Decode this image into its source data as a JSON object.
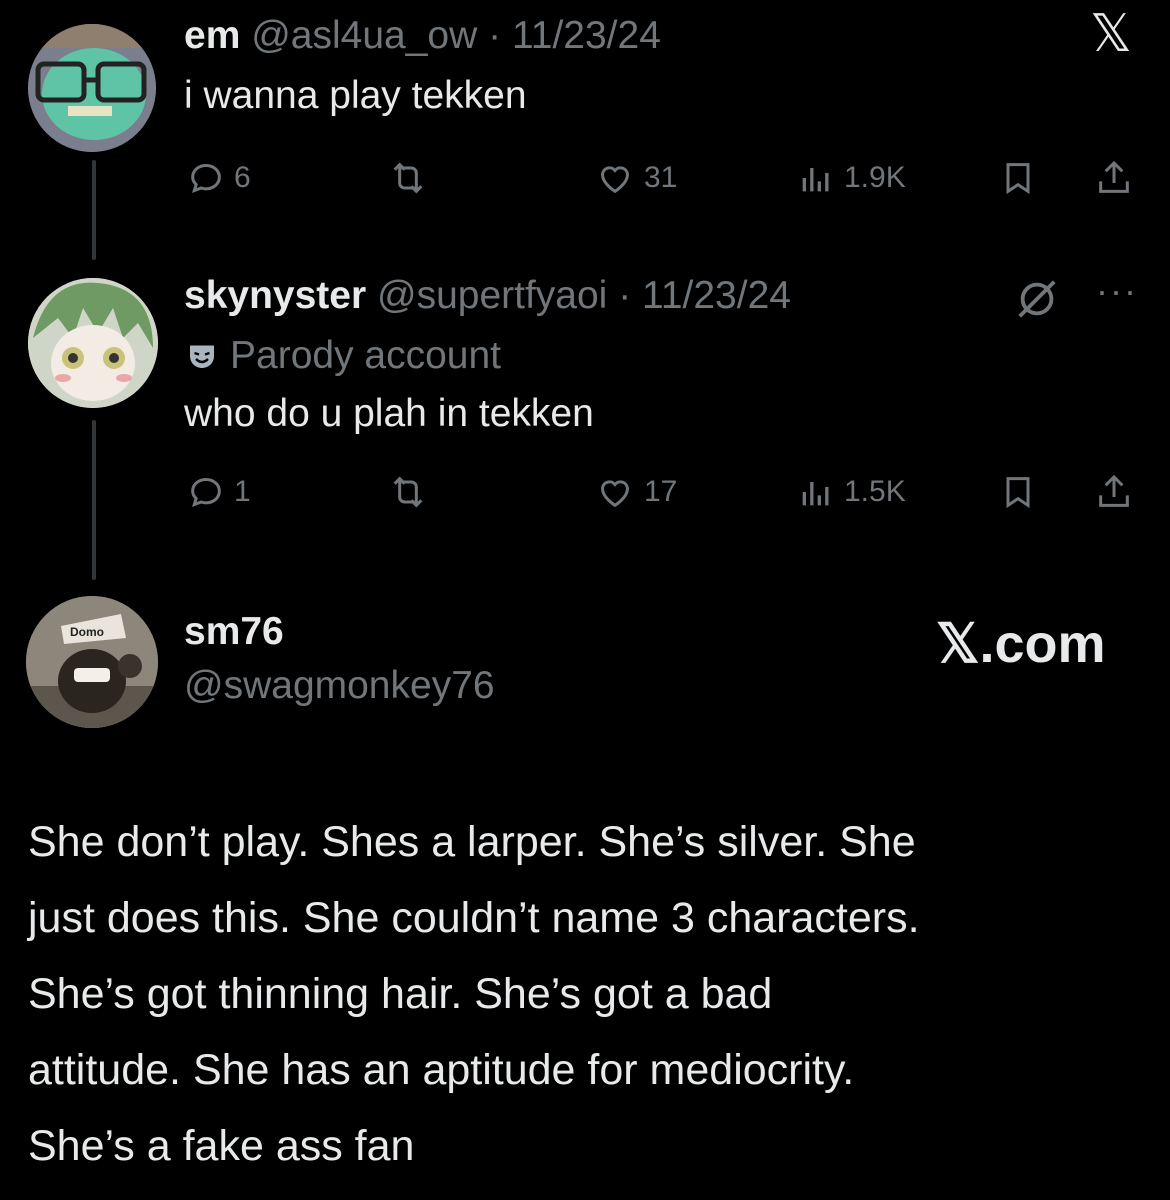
{
  "tweet1": {
    "display_name": "em",
    "handle": "@asl4ua_ow",
    "separator": "·",
    "date": "11/23/24",
    "text": "i wanna play tekken",
    "stats": {
      "replies": "6",
      "retweets": "",
      "likes": "31",
      "views": "1.9K"
    }
  },
  "tweet2": {
    "display_name": "skynyster",
    "handle": "@supertfyaoi",
    "separator": "·",
    "date": "11/23/24",
    "badge_label": "Parody account",
    "text": "who do u plah in tekken",
    "stats": {
      "replies": "1",
      "retweets": "",
      "likes": "17",
      "views": "1.5K"
    }
  },
  "tweet3": {
    "display_name": "sm76",
    "handle": "@swagmonkey76",
    "avatar_text": "Domo",
    "brand": "𝕏.com",
    "lines": [
      "She don’t play. Shes a larper. She’s silver. She",
      "just does this. She couldn’t name 3 characters.",
      "She’s got thinning hair. She’s got a bad",
      "attitude. She has an aptitude for mediocrity.",
      "She’s a fake ass fan"
    ]
  },
  "header": {
    "logo": "𝕏"
  },
  "colors": {
    "background": "#000000",
    "text": "#e7e9ea",
    "muted": "#71767b",
    "thread_line": "#333639"
  }
}
